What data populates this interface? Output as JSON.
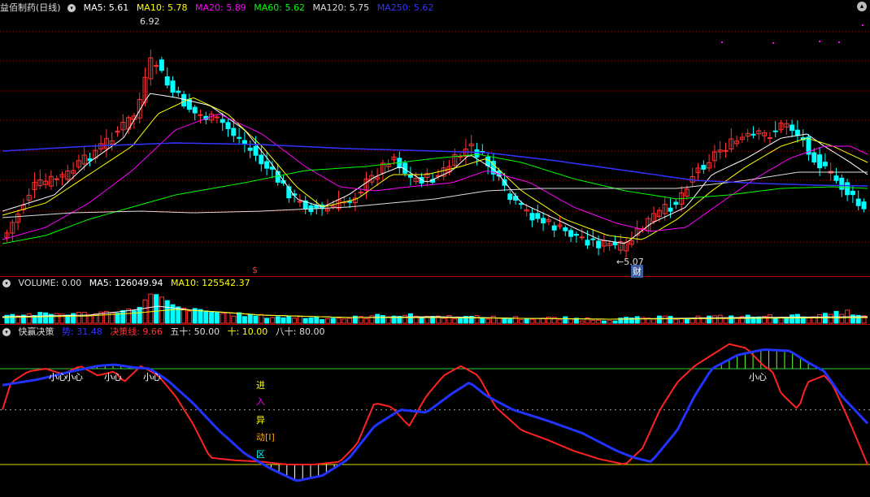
{
  "main": {
    "title": "益佰制药(日线)",
    "ma5": "MA5: 5.61",
    "ma10": "MA10: 5.78",
    "ma20": "MA20: 5.89",
    "ma60": "MA60: 5.62",
    "ma120": "MA120: 5.75",
    "ma250": "MA250: 5.62",
    "high_label": "6.92",
    "low_label": "5.07",
    "dollar": "$",
    "cai": "财"
  },
  "volume": {
    "title": "VOLUME: 0.00",
    "ma5": "MA5: 126049.94",
    "ma10": "MA10: 125542.37"
  },
  "indicator": {
    "title": "快赢决策",
    "shi": "势: 31.48",
    "jue": "决策线: 9.66",
    "wushi": "五十: 50.00",
    "shi10": "十: 10.00",
    "bashi": "八十: 80.00",
    "vertical": [
      "进",
      "入",
      "异",
      "动[I]",
      "区"
    ],
    "xiaoxin": [
      "小心",
      "小心",
      "小心",
      "小心",
      "小心"
    ]
  },
  "colors": {
    "ma5": "#ffffff",
    "ma10": "#ffff00",
    "ma20": "#ff00ff",
    "ma60": "#00ff00",
    "ma120": "#dddddd",
    "ma250": "#3333ff",
    "up": "#ff3333",
    "down": "#00ffff",
    "grid": "#a00000"
  }
}
